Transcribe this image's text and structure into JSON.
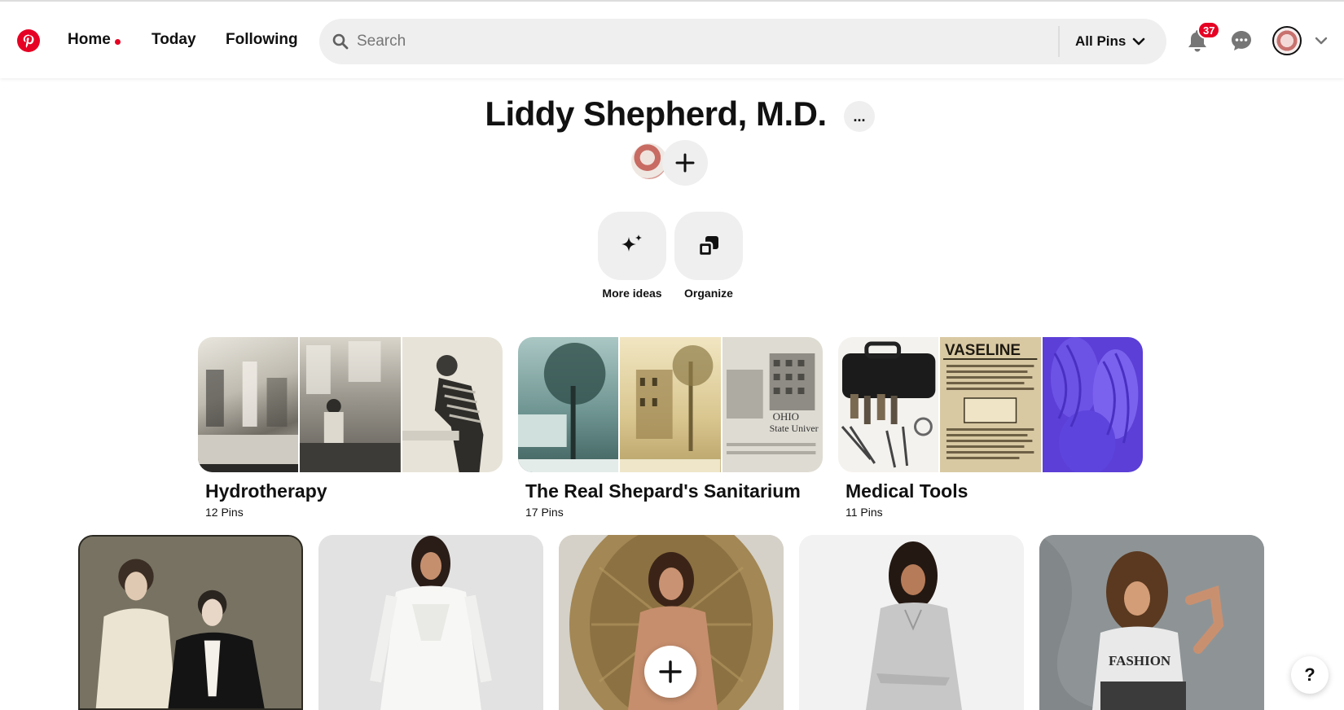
{
  "nav": {
    "home_label": "Home",
    "today_label": "Today",
    "following_label": "Following"
  },
  "search": {
    "placeholder": "Search",
    "filter_label": "All Pins"
  },
  "notifications": {
    "count": "37"
  },
  "board": {
    "title": "Liddy Shepherd, M.D.",
    "more_label": "..."
  },
  "actions": {
    "more_ideas": "More ideas",
    "organize": "Organize"
  },
  "sections": [
    {
      "title": "Hydrotherapy",
      "count": "12 Pins"
    },
    {
      "title": "The Real Shepard's Sanitarium",
      "count": "17 Pins"
    },
    {
      "title": "Medical Tools",
      "count": "11 Pins"
    }
  ],
  "cover_text": {
    "vaseline": "VASELINE",
    "ohio": "OHIO",
    "state_univ": "State Univer"
  },
  "pin_text": {
    "shirt": "FASHION"
  },
  "help_label": "?",
  "colors": {
    "brand": "#e60023",
    "pill_bg": "#efefef"
  }
}
